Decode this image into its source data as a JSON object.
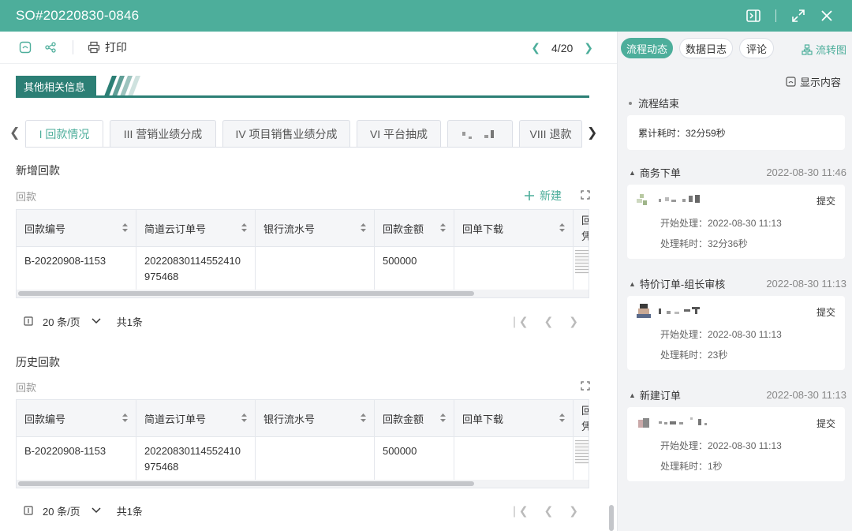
{
  "window": {
    "title": "SO#20220830-0846"
  },
  "toolbar": {
    "print_label": "打印",
    "page_indicator": "4/20"
  },
  "section": {
    "title": "其他相关信息"
  },
  "tabs": [
    {
      "label": "I 回款情况",
      "active": true
    },
    {
      "label": "III 营销业绩分成",
      "active": false
    },
    {
      "label": "IV 项目销售业绩分成",
      "active": false
    },
    {
      "label": "VI 平台抽成",
      "active": false
    },
    {
      "label": "",
      "active": false
    },
    {
      "label": "VIII 退款",
      "active": false
    }
  ],
  "new_payment": {
    "title": "新增回款",
    "sub_label": "回款",
    "new_button": "新建",
    "columns": [
      "回款编号",
      "简道云订单号",
      "银行流水号",
      "回款金额",
      "回单下载",
      "回",
      "凭"
    ],
    "rows": [
      {
        "id": "B-20220908-1153",
        "order_no_1": "20220830114552410",
        "order_no_2": "975468",
        "bank_no": "",
        "amount": "500000"
      }
    ],
    "pager": {
      "page_size": "20 条/页",
      "total": "共1条"
    }
  },
  "history_payment": {
    "title": "历史回款",
    "sub_label": "回款",
    "columns": [
      "回款编号",
      "简道云订单号",
      "银行流水号",
      "回款金额",
      "回单下载",
      "回",
      "凭"
    ],
    "rows": [
      {
        "id": "B-20220908-1153",
        "order_no_1": "20220830114552410",
        "order_no_2": "975468",
        "bank_no": "",
        "amount": "500000"
      }
    ],
    "pager": {
      "page_size": "20 条/页",
      "total": "共1条"
    }
  },
  "side": {
    "tabs": [
      "流程动态",
      "数据日志",
      "评论"
    ],
    "flow_chart_link": "流转图",
    "show_content": "显示内容",
    "end_label": "流程结束",
    "total_time": "累计耗时：32分59秒",
    "steps": [
      {
        "name": "商务下单",
        "time": "2022-08-30 11:46",
        "action": "提交",
        "start": "开始处理：2022-08-30 11:13",
        "duration": "处理耗时：32分36秒"
      },
      {
        "name": "特价订单-组长审核",
        "time": "2022-08-30 11:13",
        "action": "提交",
        "start": "开始处理：2022-08-30 11:13",
        "duration": "处理耗时：23秒"
      },
      {
        "name": "新建订单",
        "time": "2022-08-30 11:13",
        "action": "提交",
        "start": "开始处理：2022-08-30 11:13",
        "duration": "处理耗时：1秒"
      }
    ]
  },
  "colors": {
    "brand": "#4dae9b",
    "section_dark": "#2c7f75",
    "sidebar_bg": "#f2f3f5"
  }
}
